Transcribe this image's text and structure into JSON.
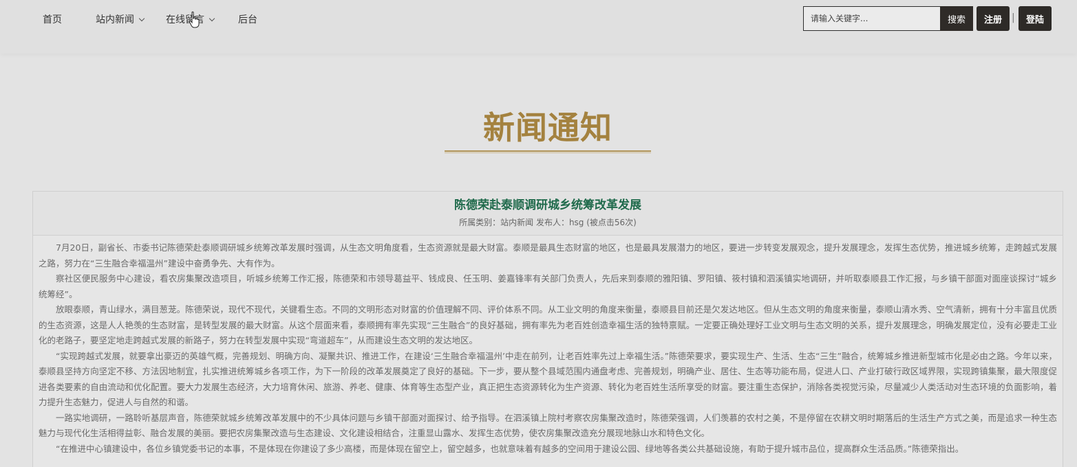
{
  "nav": {
    "items": [
      {
        "label": "首页",
        "has_dropdown": false
      },
      {
        "label": "站内新闻",
        "has_dropdown": true
      },
      {
        "label": "在线留言",
        "has_dropdown": true
      },
      {
        "label": "后台",
        "has_dropdown": false
      }
    ]
  },
  "search": {
    "placeholder": "请输入关键字...",
    "button_label": "搜索"
  },
  "auth": {
    "register_label": "注册",
    "separator": "|",
    "login_label": "登陆"
  },
  "page": {
    "title": "新闻通知"
  },
  "article": {
    "title": "陈德荣赴泰顺调研城乡统筹改革发展",
    "meta": "所属类别：站内新闻 发布人：hsg (被点击56次)",
    "paragraphs": [
      "7月20日，副省长、市委书记陈德荣赴泰顺调研城乡统筹改革发展时强调，从生态文明角度看，生态资源就是最大财富。泰顺是最具生态财富的地区，也是最具发展潜力的地区，要进一步转变发展观念，提升发展理念，发挥生态优势，推进城乡统筹，走跨越式发展之路，努力在“三生融合幸福温州”建设中奋勇争先、大有作为。",
      "察社区便民服务中心建设，看农房集聚改造项目，听城乡统筹工作汇报，陈德荣和市领导葛益平、钱成良、任玉明、姜嘉锋率有关部门负责人，先后来到泰顺的雅阳镇、罗阳镇、筱村镇和泗溪镇实地调研，并听取泰顺县工作汇报，与乡镇干部面对面座谈探讨“城乡统筹经”。",
      "放眼泰顺，青山绿水，满目葱茏。陈德荣说，现代不现代，关键看生态。不同的文明形态对财富的价值理解不同、评价体系不同。从工业文明的角度来衡量，泰顺县目前还是欠发达地区。但从生态文明的角度来衡量，泰顺山清水秀、空气清新，拥有十分丰富且优质的生态资源，这是人人艳羡的生态财富，是转型发展的最大财富。从这个层面来看，泰顺拥有率先实现“三生融合”的良好基础，拥有率先为老百姓创造幸福生活的独特禀赋。一定要正确处理好工业文明与生态文明的关系，提升发展理念，明确发展定位，没有必要走工业化的老路子，要坚定地走跨越式发展的新路子，努力在转型发展中实现“弯道超车”，从而建设生态文明的发达地区。",
      "“实现跨越式发展，就要拿出豪迈的英雄气概，完善规划、明确方向、凝聚共识、推进工作，在建设‘三生融合幸福温州’中走在前列，让老百姓率先过上幸福生活。”陈德荣要求，要实现生产、生活、生态“三生”融合，统筹城乡推进新型城市化是必由之路。今年以来，泰顺县坚持方向坚定不移、方法因地制宜，扎实推进统筹城乡各项工作，为下一阶段的改革发展奠定了良好的基础。下一步，要从整个县域范围内通盘考虑、完善规划，明确产业、居住、生态等功能布局，促进人口、产业打破行政区域界限，实现跨镇集聚，最大限度促进各类要素的自由流动和优化配置。要大力发展生态经济，大力培育休闲、旅游、养老、健康、体育等生态型产业，真正把生态资源转化为生产资源、转化为老百姓生活所享受的财富。要注重生态保护，消除各类视觉污染，尽量减少人类活动对生态环境的负面影响，着力提升生态魅力，促进人与自然的和谐。",
      "一路实地调研，一路聆听基层声音，陈德荣就城乡统筹改革发展中的不少具体问题与乡镇干部面对面探讨、给予指导。在泗溪镇上院村考察农房集聚改造时，陈德荣强调，人们羡慕的农村之美，不是停留在农耕文明时期落后的生活生产方式之美，而是追求一种生态魅力与现代化生活相得益彰、融合发展的美丽。要把农房集聚改造与生态建设、文化建设相结合，注重显山露水、发挥生态优势，使农房集聚改造充分展现地脉山水和特色文化。",
      "“在推进中心镇建设中，各位乡镇党委书记的本事，不是体现在你建设了多少高楼，而是体现在留空上，留空越多，也就意味着有越多的空间用于建设公园、绿地等各类公共基础设施，有助于提升城市品位，提高群众生活品质。”陈德荣指出。"
    ]
  }
}
